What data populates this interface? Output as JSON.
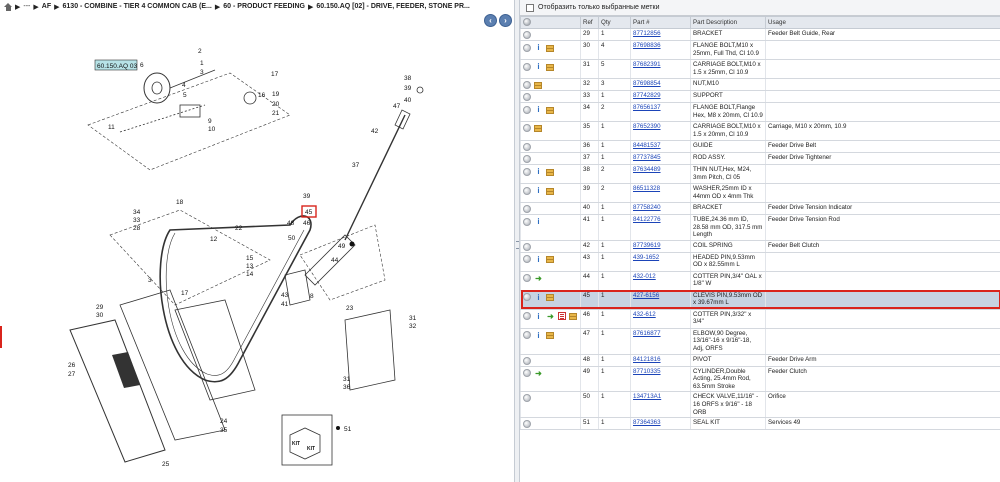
{
  "breadcrumb": {
    "home_icon": "home-icon",
    "items": [
      "---",
      "AF",
      "6130 - COMBINE - TIER 4 COMMON CAB (E...",
      "60 - PRODUCT FEEDING",
      "60.150.AQ [02] - DRIVE, FEEDER, STONE PR..."
    ]
  },
  "nav": {
    "prev_icon": "arrow-left-icon",
    "next_icon": "arrow-right-icon"
  },
  "diagram": {
    "title_label": "60.150.AQ 03",
    "selected_callout": "45",
    "kit_text": "KIT",
    "callouts": [
      "1",
      "2",
      "3",
      "4",
      "5",
      "6",
      "7",
      "8",
      "9",
      "10",
      "11",
      "12",
      "13",
      "14",
      "15",
      "16",
      "17",
      "18",
      "19",
      "20",
      "21",
      "22",
      "23",
      "24",
      "25",
      "26",
      "27",
      "28",
      "29",
      "30",
      "31",
      "32",
      "33",
      "34",
      "35",
      "36",
      "37",
      "38",
      "39",
      "40",
      "41",
      "42",
      "43",
      "44",
      "46",
      "47",
      "48",
      "49",
      "50",
      "51"
    ]
  },
  "filter": {
    "label": "Отобразить только выбранные метки"
  },
  "columns": [
    "Ref",
    "Qty",
    "Part #",
    "Part Description",
    "Usage"
  ],
  "accent": {
    "selection_outline": "#d9241c",
    "link": "#1b44b8",
    "selected_row_bg": "#c7d3e2"
  },
  "rows": [
    {
      "ref": "29",
      "qty": "1",
      "part": "87712856",
      "desc": "BRACKET",
      "usage": "Feeder Belt Guide, Rear",
      "icons": []
    },
    {
      "ref": "30",
      "qty": "4",
      "part": "87698836",
      "desc": "FLANGE BOLT,M10 x 25mm, Full Thd, Cl 10.9",
      "usage": "",
      "icons": [
        "info",
        "box"
      ]
    },
    {
      "ref": "31",
      "qty": "5",
      "part": "87682391",
      "desc": "CARRIAGE BOLT,M10 x 1.5 x 25mm, Cl 10.9",
      "usage": "",
      "icons": [
        "info",
        "box"
      ]
    },
    {
      "ref": "32",
      "qty": "3",
      "part": "87698854",
      "desc": "NUT,M10",
      "usage": "",
      "icons": [
        "box"
      ]
    },
    {
      "ref": "33",
      "qty": "1",
      "part": "87742829",
      "desc": "SUPPORT",
      "usage": "",
      "icons": []
    },
    {
      "ref": "34",
      "qty": "2",
      "part": "87656137",
      "desc": "FLANGE BOLT,Flange Hex, M8 x 20mm, Cl 10.9",
      "usage": "",
      "icons": [
        "info",
        "box"
      ]
    },
    {
      "ref": "35",
      "qty": "1",
      "part": "87652390",
      "desc": "CARRIAGE BOLT,M10 x 1.5 x 20mm, Cl 10.9",
      "usage": "Carriage, M10 x 20mm, 10.9",
      "icons": [
        "box"
      ]
    },
    {
      "ref": "36",
      "qty": "1",
      "part": "84481537",
      "desc": "GUIDE",
      "usage": "Feeder Drive Belt",
      "icons": []
    },
    {
      "ref": "37",
      "qty": "1",
      "part": "87737845",
      "desc": "ROD ASSY.",
      "usage": "Feeder Drive Tightener",
      "icons": []
    },
    {
      "ref": "38",
      "qty": "2",
      "part": "87634489",
      "desc": "THIN NUT,Hex, M24, 3mm Pitch, Cl 05",
      "usage": "",
      "icons": [
        "info",
        "box"
      ]
    },
    {
      "ref": "39",
      "qty": "2",
      "part": "86511328",
      "desc": "WASHER,25mm ID x 44mm OD x 4mm Thk",
      "usage": "",
      "icons": [
        "info",
        "box"
      ]
    },
    {
      "ref": "40",
      "qty": "1",
      "part": "87758240",
      "desc": "BRACKET",
      "usage": "Feeder Drive Tension Indicator",
      "icons": []
    },
    {
      "ref": "41",
      "qty": "1",
      "part": "84122776",
      "desc": "TUBE,24.36 mm ID, 28.58 mm OD, 317.5 mm Length",
      "usage": "Feeder Drive Tension Rod",
      "icons": [
        "info"
      ]
    },
    {
      "ref": "42",
      "qty": "1",
      "part": "87739619",
      "desc": "COIL SPRING",
      "usage": "Feeder Belt Clutch",
      "icons": []
    },
    {
      "ref": "43",
      "qty": "1",
      "part": "439-1652",
      "desc": "HEADED PIN,9.53mm OD x 82.55mm L",
      "usage": "",
      "icons": [
        "info",
        "box"
      ]
    },
    {
      "ref": "44",
      "qty": "1",
      "part": "432-012",
      "desc": "COTTER PIN,3/4\" OAL x 1/8\" W",
      "usage": "",
      "icons": [
        "green"
      ]
    },
    {
      "ref": "45",
      "qty": "1",
      "part": "427-6156",
      "desc": "CLEVIS PIN,9.53mm OD x 39.67mm L",
      "usage": "",
      "icons": [
        "info",
        "box"
      ],
      "selected": true
    },
    {
      "ref": "46",
      "qty": "1",
      "part": "432-612",
      "desc": "COTTER PIN,3/32\" x 3/4\"",
      "usage": "",
      "icons": [
        "info",
        "green",
        "doc",
        "box"
      ]
    },
    {
      "ref": "47",
      "qty": "1",
      "part": "87616877",
      "desc": "ELBOW,90 Degree, 13/16\"-16 x 9/16\"-18, Adj, ORFS",
      "usage": "",
      "icons": [
        "info",
        "box"
      ]
    },
    {
      "ref": "48",
      "qty": "1",
      "part": "84121816",
      "desc": "PIVOT",
      "usage": "Feeder Drive Arm",
      "icons": []
    },
    {
      "ref": "49",
      "qty": "1",
      "part": "87710335",
      "desc": "CYLINDER,Double Acting, 25.4mm Rod, 63.5mm Stroke",
      "usage": "Feeder Clutch",
      "icons": [
        "green"
      ]
    },
    {
      "ref": "50",
      "qty": "1",
      "part": "134713A1",
      "desc": "CHECK VALVE,11/16\" - 16 ORFS x 9/16\" - 18 ORB",
      "usage": "Orifice",
      "icons": []
    },
    {
      "ref": "51",
      "qty": "1",
      "part": "87364363",
      "desc": "SEAL KIT",
      "usage": "Services 49",
      "icons": []
    }
  ]
}
